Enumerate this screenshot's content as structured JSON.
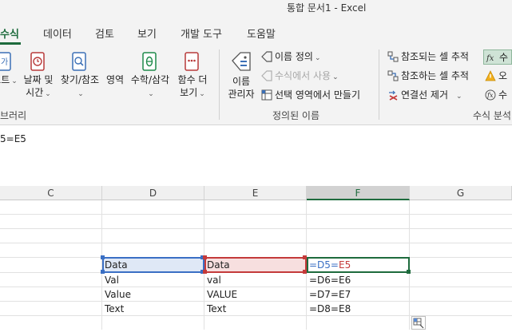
{
  "window": {
    "title": "통합 문서1  -  Excel"
  },
  "tabs": [
    {
      "label": "수식",
      "active": true
    },
    {
      "label": "데이터"
    },
    {
      "label": "검토"
    },
    {
      "label": "보기"
    },
    {
      "label": "개발 도구"
    },
    {
      "label": "도움말"
    }
  ],
  "ribbon": {
    "library": {
      "text_partial": "스트",
      "datetime": [
        "날짜 및",
        "시간"
      ],
      "lookup": [
        "찾기/참조",
        ""
      ],
      "area": "영역",
      "math": "수학/삼각",
      "more": [
        "함수 더",
        "보기"
      ],
      "group_label": "브러리"
    },
    "names": {
      "manager": [
        "이름",
        "관리자"
      ],
      "define": "이름 정의",
      "use_in_formula": "수식에서 사용",
      "create_from_sel": "선택 영역에서 만들기",
      "group_label": "정의된 이름"
    },
    "audit": {
      "trace_precedents": "참조되는 셀 추적",
      "trace_dependents": "참조하는 셀 추적",
      "remove_arrows": "연결선 제거",
      "show_formulas": "수",
      "error_check": "오",
      "evaluate": "수",
      "group_label": "수식 분석"
    }
  },
  "formula_bar": {
    "text": "5=E5"
  },
  "columns": [
    "C",
    "D",
    "E",
    "F",
    "G"
  ],
  "selected_column": "F",
  "rows": [
    {
      "D": "Data",
      "E": "Data",
      "F_a": "=D5=",
      "F_b": "E5"
    },
    {
      "D": "Val",
      "E": "val",
      "F": "=D6=E6"
    },
    {
      "D": "Value",
      "E": "VALUE",
      "F": "=D7=E7"
    },
    {
      "D": "Text",
      "E": "Text",
      "F": "=D8=E8"
    }
  ],
  "colors": {
    "accent": "#1e6b3d",
    "ref_blue": "#3a6fc4",
    "ref_red": "#c43a3a"
  }
}
